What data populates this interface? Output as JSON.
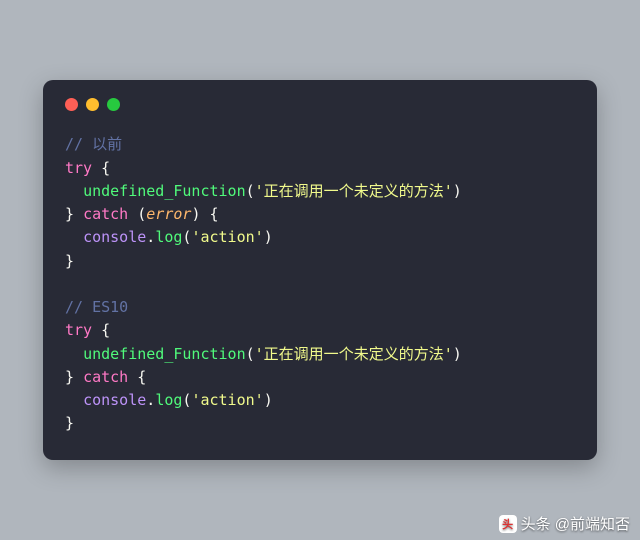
{
  "code": {
    "block1": {
      "comment": "// 以前",
      "line1_try": "try",
      "line1_brace": " {",
      "line2_indent": "  ",
      "line2_func": "undefined_Function",
      "line2_open": "(",
      "line2_str": "'正在调用一个未定义的方法'",
      "line2_close": ")",
      "line3_close": "} ",
      "line3_catch": "catch",
      "line3_open": " (",
      "line3_param": "error",
      "line3_brace": ") {",
      "line4_indent": "  ",
      "line4_obj": "console",
      "line4_dot": ".",
      "line4_method": "log",
      "line4_open": "(",
      "line4_str": "'action'",
      "line4_close": ")",
      "line5": "}"
    },
    "block2": {
      "comment": "// ES10",
      "line1_try": "try",
      "line1_brace": " {",
      "line2_indent": "  ",
      "line2_func": "undefined_Function",
      "line2_open": "(",
      "line2_str": "'正在调用一个未定义的方法'",
      "line2_close": ")",
      "line3_close": "} ",
      "line3_catch": "catch",
      "line3_brace": " {",
      "line4_indent": "  ",
      "line4_obj": "console",
      "line4_dot": ".",
      "line4_method": "log",
      "line4_open": "(",
      "line4_str": "'action'",
      "line4_close": ")",
      "line5": "}"
    }
  },
  "watermark": {
    "text": "头条 @前端知否"
  },
  "colors": {
    "bg": "#b0b6bd",
    "window": "#282a36"
  }
}
